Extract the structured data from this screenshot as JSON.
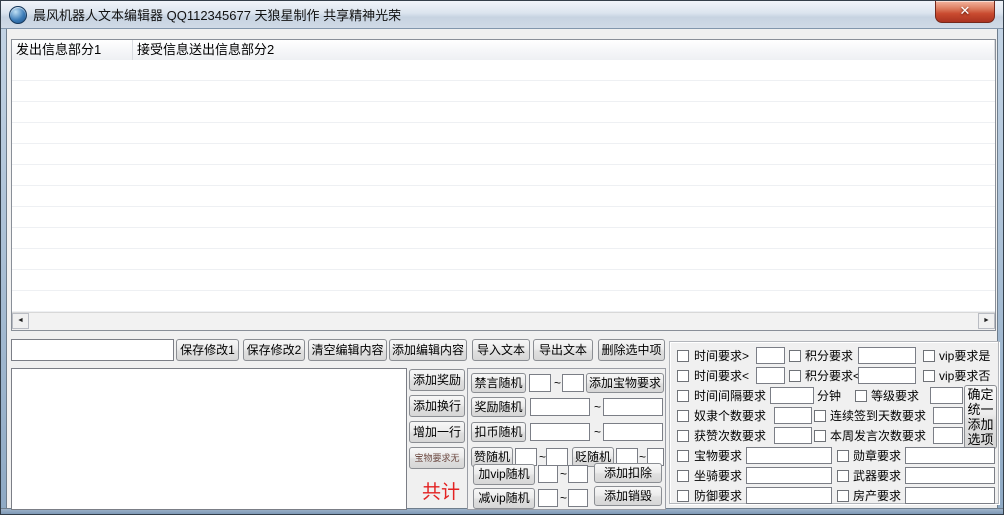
{
  "window": {
    "title": "晨风机器人文本编辑器  QQ112345677 天狼星制作  共享精神光荣"
  },
  "icons": {
    "close": "✕",
    "scroll_left": "◄",
    "scroll_right": "►"
  },
  "colors": {
    "close_red": "#c94b30",
    "total_red": "#e32222",
    "treasure_none_text": "#6d4a42",
    "titlebar": "#d4dee9"
  },
  "list": {
    "columns": [
      "发出信息部分1",
      "接受信息送出信息部分2"
    ]
  },
  "toolbar": {
    "input_value": "",
    "buttons": [
      "保存修改1",
      "保存修改2",
      "清空编辑内容",
      "添加编辑内容",
      "导入文本",
      "导出文本",
      "删除选中项"
    ]
  },
  "editor": {
    "value": ""
  },
  "edit_actions": {
    "add_reward": "添加奖励",
    "add_newline": "添加换行",
    "add_row": "增加一行",
    "treasure_none": "宝物要求无",
    "total": "共计"
  },
  "random": {
    "mute": "禁言随机",
    "add_treasure": "添加宝物要求",
    "reward": "奖励随机",
    "deduct_coin": "扣币随机",
    "praise": "赞随机",
    "demote": "贬随机",
    "add_vip": "加vip随机",
    "add_deduct": "添加扣除",
    "sub_vip": "减vip随机",
    "add_destroy": "添加销毁",
    "tilde": "~"
  },
  "requirements": {
    "rows": [
      {
        "a": "时间要求>",
        "b": "积分要求",
        "c": "vip要求是"
      },
      {
        "a": "时间要求<",
        "b": "积分要求<",
        "c": "vip要求否"
      },
      {
        "a": "时间间隔要求",
        "unit": "分钟",
        "b": "等级要求"
      },
      {
        "a": "奴隶个数要求",
        "b": "连续签到天数要求"
      },
      {
        "a": "获赞次数要求",
        "b": "本周发言次数要求"
      },
      {
        "a": "宝物要求",
        "b": "勋章要求"
      },
      {
        "a": "坐骑要求",
        "b": "武器要求"
      },
      {
        "a": "防御要求",
        "b": "房产要求"
      }
    ],
    "confirm_button": "确定统一添加选项"
  }
}
